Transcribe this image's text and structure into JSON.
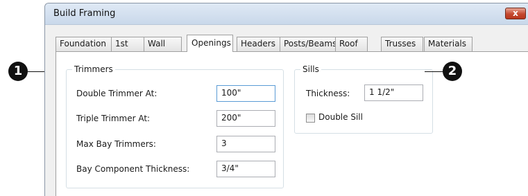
{
  "window": {
    "title": "Build Framing",
    "close_glyph": "x"
  },
  "tabs": [
    {
      "label": "Foundation",
      "active": false
    },
    {
      "label": "1st",
      "active": false
    },
    {
      "label": "Wall",
      "active": false
    },
    {
      "label": "Openings",
      "active": true
    },
    {
      "label": "Headers",
      "active": false
    },
    {
      "label": "Posts/Beams",
      "active": false
    },
    {
      "label": "Roof",
      "active": false
    },
    {
      "label": "Trusses",
      "active": false
    },
    {
      "label": "Materials",
      "active": false
    }
  ],
  "trimmers": {
    "legend": "Trimmers",
    "double_trimmer": {
      "label": "Double Trimmer At:",
      "value": "100\""
    },
    "triple_trimmer": {
      "label": "Triple Trimmer At:",
      "value": "200\""
    },
    "max_bay": {
      "label": "Max Bay Trimmers:",
      "value": "3"
    },
    "bay_thickness": {
      "label": "Bay Component Thickness:",
      "value": "3/4\""
    }
  },
  "sills": {
    "legend": "Sills",
    "thickness": {
      "label": "Thickness:",
      "value": "1 1/2\""
    },
    "double_sill": {
      "label": "Double Sill",
      "checked": false
    }
  },
  "callouts": {
    "one": "1",
    "two": "2"
  },
  "colors": {
    "focus_border": "#5a9bd5",
    "close_button": "#c4482f"
  }
}
